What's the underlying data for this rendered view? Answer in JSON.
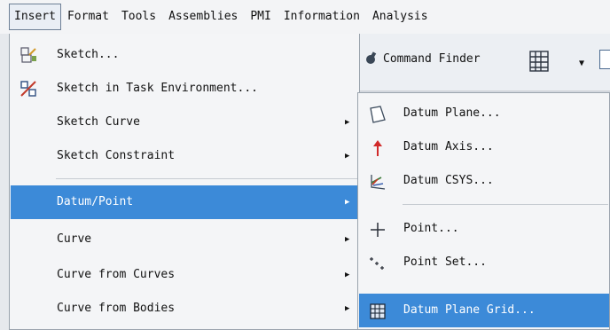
{
  "menubar": {
    "items": [
      {
        "label": "Insert",
        "active": true
      },
      {
        "label": "Format"
      },
      {
        "label": "Tools"
      },
      {
        "label": "Assemblies"
      },
      {
        "label": "PMI"
      },
      {
        "label": "Information"
      },
      {
        "label": "Analysis"
      }
    ]
  },
  "toolbar": {
    "command_finder_label": "Command Finder"
  },
  "insert_menu": {
    "items": [
      {
        "label": "Sketch...",
        "icon": "sketch-icon"
      },
      {
        "label": "Sketch in Task Environment...",
        "icon": "sketch-task-env-icon"
      },
      {
        "label": "Sketch Curve",
        "submenu": true
      },
      {
        "label": "Sketch Constraint",
        "submenu": true
      },
      {
        "label": "Datum/Point",
        "submenu": true,
        "selected": true
      },
      {
        "label": "Curve",
        "submenu": true
      },
      {
        "label": "Curve from Curves",
        "submenu": true
      },
      {
        "label": "Curve from Bodies",
        "submenu": true
      }
    ]
  },
  "datum_submenu": {
    "items": [
      {
        "label": "Datum Plane...",
        "icon": "datum-plane-icon"
      },
      {
        "label": "Datum Axis...",
        "icon": "datum-axis-icon"
      },
      {
        "label": "Datum CSYS...",
        "icon": "datum-csys-icon"
      },
      {
        "label": "Point...",
        "icon": "point-icon"
      },
      {
        "label": "Point Set...",
        "icon": "point-set-icon"
      },
      {
        "label": "Datum Plane Grid...",
        "icon": "datum-plane-grid-icon",
        "selected": true
      }
    ]
  },
  "colors": {
    "selection": "#3c8ad8",
    "menu_bg": "#f4f5f7"
  }
}
